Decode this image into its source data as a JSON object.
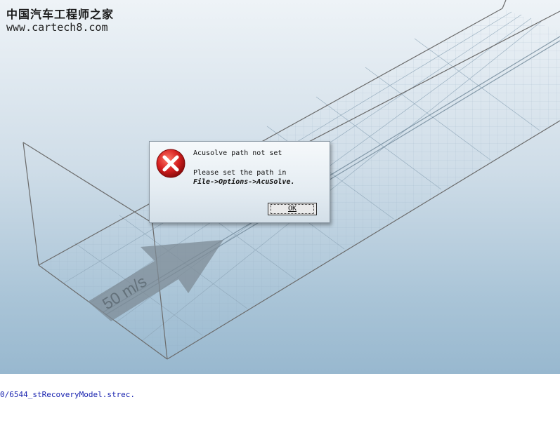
{
  "watermark": {
    "site_name": "中国汽车工程师之家",
    "url": "www.cartech8.com"
  },
  "viewport": {
    "velocity_label": "50 m/s",
    "arrow_icon": "flow-direction-arrow-icon"
  },
  "dialog": {
    "icon": "error-icon",
    "title": "Acusolve path not set",
    "message_line1": "Please set the path in",
    "message_line2": "File->Options->AcuSolve.",
    "ok_label": "OK"
  },
  "console": {
    "line": "0/6544_stRecoveryModel.strec."
  },
  "colors": {
    "console_text": "#1a24b0",
    "error_red": "#d62020"
  }
}
